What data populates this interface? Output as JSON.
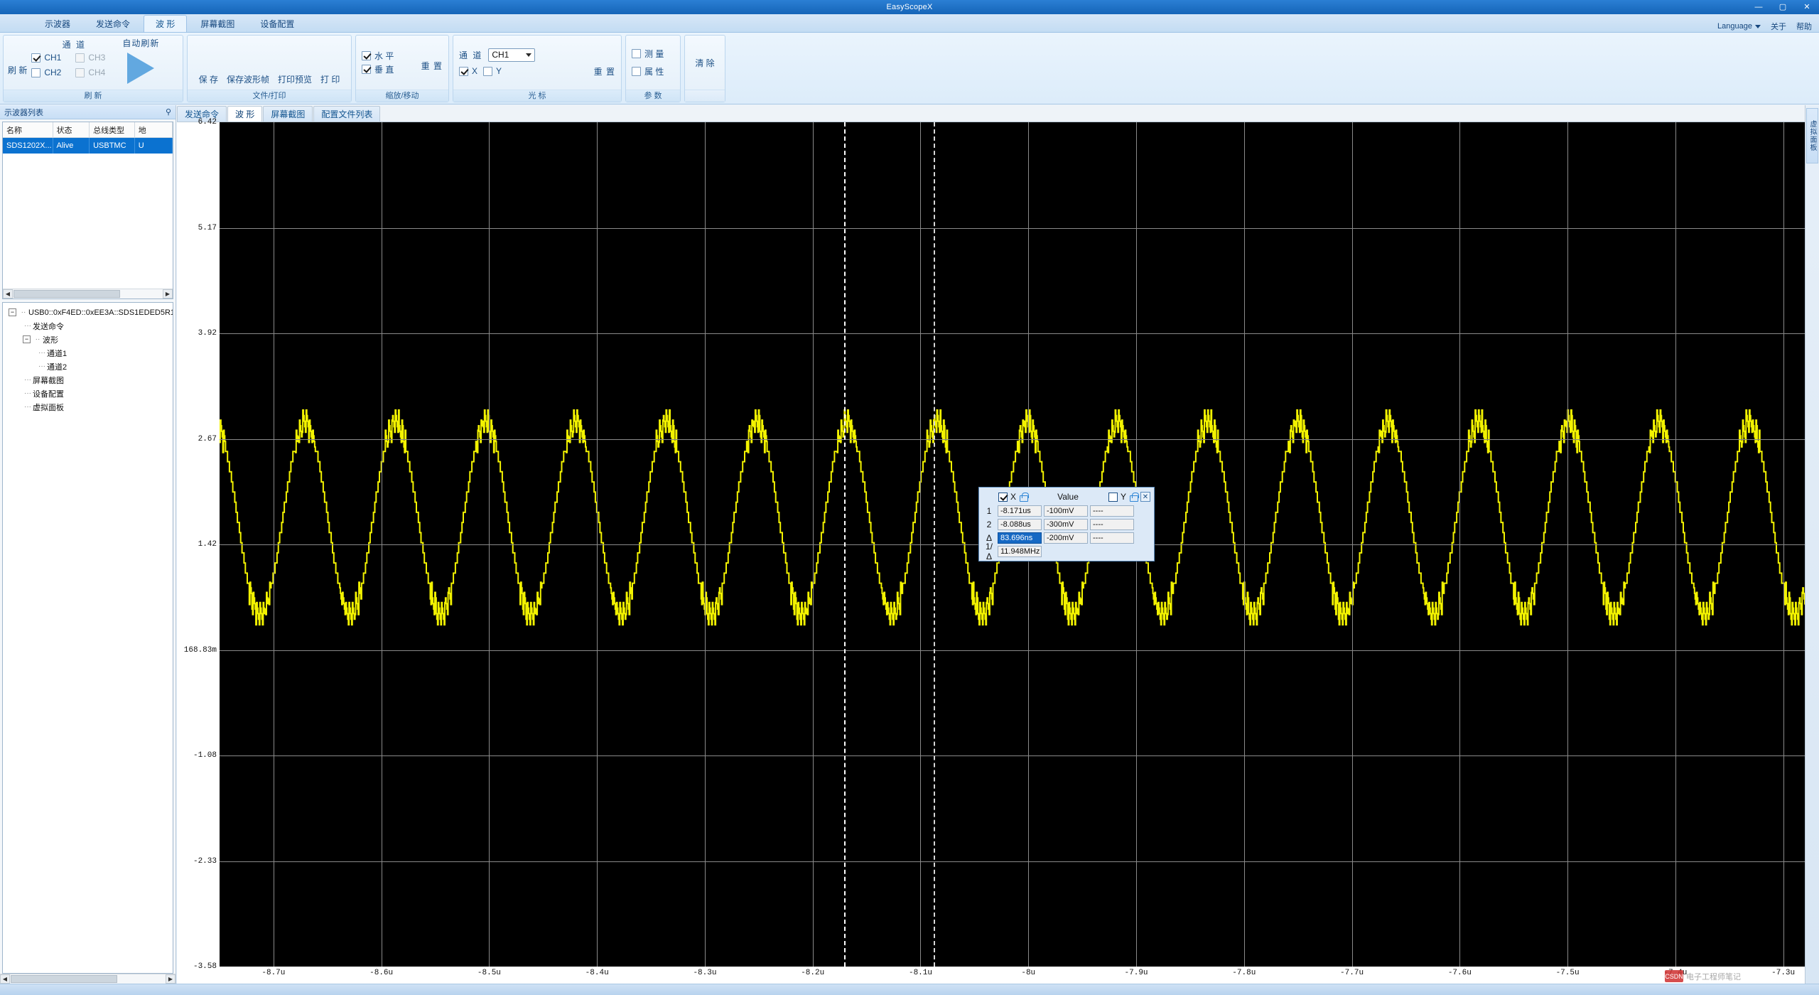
{
  "window": {
    "title": "EasyScopeX",
    "minimize": "—",
    "maximize": "▢",
    "close": "✕"
  },
  "ribbon": {
    "tabs": [
      {
        "label": "示波器",
        "active": false
      },
      {
        "label": "发送命令",
        "active": false
      },
      {
        "label": "波 形",
        "active": true
      },
      {
        "label": "屏幕截图",
        "active": false
      },
      {
        "label": "设备配置",
        "active": false
      }
    ],
    "right": {
      "language": "Language",
      "about": "关于",
      "help": "帮助"
    },
    "groups": {
      "refresh": {
        "title": "刷 新",
        "refresh_button": "刷 新",
        "channel_header": "通 道",
        "auto_refresh": "自动刷新",
        "channels": [
          {
            "label": "CH1",
            "checked": true,
            "enabled": true
          },
          {
            "label": "CH3",
            "checked": false,
            "enabled": false
          },
          {
            "label": "CH2",
            "checked": false,
            "enabled": true
          },
          {
            "label": "CH4",
            "checked": false,
            "enabled": false
          }
        ],
        "play_icon": "play-triangle-icon"
      },
      "file": {
        "title": "文件/打印",
        "items": [
          "保 存",
          "保存波形帧",
          "打印预览",
          "打 印"
        ]
      },
      "zoom": {
        "title": "缩放/移动",
        "horizontal": {
          "label": "水 平",
          "checked": true
        },
        "vertical": {
          "label": "垂 直",
          "checked": true
        },
        "reset": "重 置"
      },
      "cursor": {
        "title": "光 标",
        "channel_label": "通 道",
        "channel_value": "CH1",
        "reset": "重 置",
        "x": {
          "label": "X",
          "checked": true
        },
        "y": {
          "label": "Y",
          "checked": false
        }
      },
      "param": {
        "title": "参 数",
        "measure": {
          "label": "测 量",
          "checked": false
        },
        "property": {
          "label": "属 性",
          "checked": false
        }
      },
      "clear": {
        "title": "",
        "label": "清 除"
      }
    }
  },
  "left_dock": {
    "caption": "示波器列表",
    "pin_icon": "pin-icon",
    "device_table": {
      "columns": [
        "名称",
        "状态",
        "总线类型",
        "地"
      ],
      "rows": [
        {
          "name": "SDS1202X...",
          "state": "Alive",
          "bus": "USBTMC",
          "addr": "U"
        }
      ]
    },
    "tree": {
      "root": "USB0::0xF4ED::0xEE3A::SDS1EDED5R1",
      "children": [
        {
          "label": "发送命令",
          "depth": 1,
          "expander": null
        },
        {
          "label": "波形",
          "depth": 1,
          "expander": "-"
        },
        {
          "label": "通道1",
          "depth": 2,
          "expander": null
        },
        {
          "label": "通道2",
          "depth": 2,
          "expander": null
        },
        {
          "label": "屏幕截图",
          "depth": 1,
          "expander": null
        },
        {
          "label": "设备配置",
          "depth": 1,
          "expander": null
        },
        {
          "label": "虚拟面板",
          "depth": 1,
          "expander": null
        }
      ]
    }
  },
  "doc_tabs": [
    {
      "label": "发送命令",
      "active": false
    },
    {
      "label": "波 形",
      "active": true
    },
    {
      "label": "屏幕截图",
      "active": false
    },
    {
      "label": "配置文件列表",
      "active": false
    }
  ],
  "right_strip": {
    "vertical_tab": "虚拟面板"
  },
  "cursor_popup": {
    "x_checkbox": {
      "label": "X",
      "checked": true
    },
    "x_lock_icon": "unlock-icon",
    "value_header": "Value",
    "y_checkbox": {
      "label": "Y",
      "checked": false
    },
    "y_lock_icon": "unlock-icon",
    "close_icon": "close-icon",
    "rows": [
      {
        "label": "1",
        "x": "-8.171us",
        "value": "-100mV",
        "y": "----",
        "selected": false
      },
      {
        "label": "2",
        "x": "-8.088us",
        "value": "-300mV",
        "y": "----",
        "selected": false
      },
      {
        "label": "Δ",
        "x": "83.696ns",
        "value": "-200mV",
        "y": "----",
        "selected": true
      },
      {
        "label": "1/Δ",
        "x": "11.948MHz",
        "value": "",
        "y": "",
        "selected": false
      }
    ]
  },
  "watermark": {
    "badge": "CSDN",
    "text": "电子工程师笔记"
  },
  "chart_data": {
    "type": "line",
    "title": "",
    "xlabel": "",
    "ylabel": "",
    "series": [
      {
        "name": "CH1",
        "color": "#f2f200",
        "description": "Quantized sine wave, ~11.95 MHz, amplitude approx 0.6 V to 2.85 V"
      }
    ],
    "x_ticks": [
      "-8.7u",
      "-8.6u",
      "-8.5u",
      "-8.4u",
      "-8.3u",
      "-8.2u",
      "-8.1u",
      "-8u",
      "-7.9u",
      "-7.8u",
      "-7.7u",
      "-7.6u",
      "-7.5u",
      "-7.4u",
      "-7.3u"
    ],
    "y_ticks": [
      "6.42",
      "5.17",
      "3.92",
      "2.67",
      "1.42",
      "168.83m",
      "-1.08",
      "-2.33",
      "-3.58"
    ],
    "y_values": [
      6.42,
      5.17,
      3.92,
      2.67,
      1.42,
      0.16883,
      -1.08,
      -2.33,
      -3.58
    ],
    "xlim": [
      -8.75,
      -7.28
    ],
    "ylim": [
      -3.58,
      6.42
    ],
    "grid": true,
    "background": "#000000",
    "cursor_x1": "-8.171us",
    "cursor_x2": "-8.088us",
    "cursor_delta": "83.696ns",
    "cursor_freq": "11.948MHz",
    "waveform": {
      "period_us": 0.0837,
      "cycles_visible": 17.6,
      "v_high": 2.85,
      "v_low": 0.6,
      "shape": "sine-quantized-staircase"
    }
  }
}
